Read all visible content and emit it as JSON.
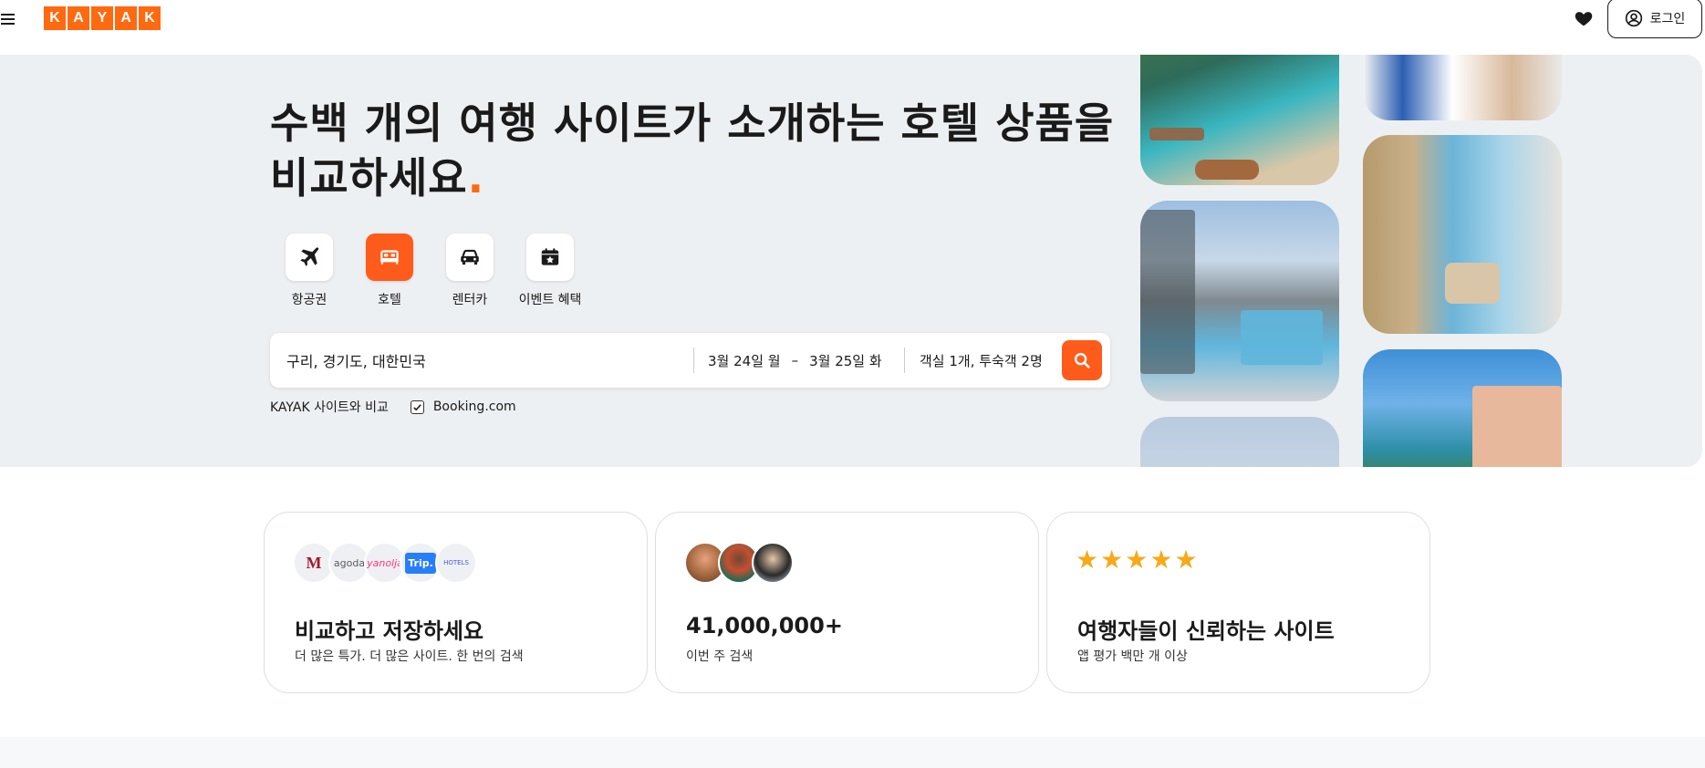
{
  "header": {
    "logo_letters": [
      "K",
      "A",
      "Y",
      "A",
      "K"
    ],
    "login_label": "로그인",
    "icons": {
      "menu": "hamburger-menu-icon",
      "favorites": "heart-icon",
      "account": "user-circle-icon"
    }
  },
  "hero": {
    "title": "수백 개의 여행 사이트가 소개하는 호텔 상품을 비교하세요",
    "title_dot": ".",
    "accent_color": "#ff690f",
    "tabs": [
      {
        "label": "항공권",
        "icon": "airplane-icon",
        "active": false
      },
      {
        "label": "호텔",
        "icon": "bed-icon",
        "active": true
      },
      {
        "label": "렌터카",
        "icon": "car-icon",
        "active": false
      },
      {
        "label": "이벤트 혜택",
        "icon": "calendar-star-icon",
        "active": false
      }
    ],
    "search": {
      "destination": "구리, 경기도, 대한민국",
      "check_in": "3월 24일 월",
      "date_separator": "–",
      "check_out": "3월 25일 화",
      "guests": "객실 1개, 투숙객 2명"
    },
    "compare": {
      "label": "KAYAK 사이트와 비교",
      "partner": "Booking.com",
      "partner_checked": true
    }
  },
  "cards": [
    {
      "title": "비교하고 저장하세요",
      "subtitle": "더 많은 특가. 더 많은 사이트. 한 번의 검색",
      "logos": [
        "M",
        "agoda",
        "yanolja",
        "Trip.",
        "HOTELS"
      ]
    },
    {
      "title": "41,000,000+",
      "subtitle": "이번 주 검색"
    },
    {
      "title": "여행자들이 신뢰하는 사이트",
      "subtitle": "앱 평가 백만 개 이상",
      "rating_stars": 5
    }
  ]
}
